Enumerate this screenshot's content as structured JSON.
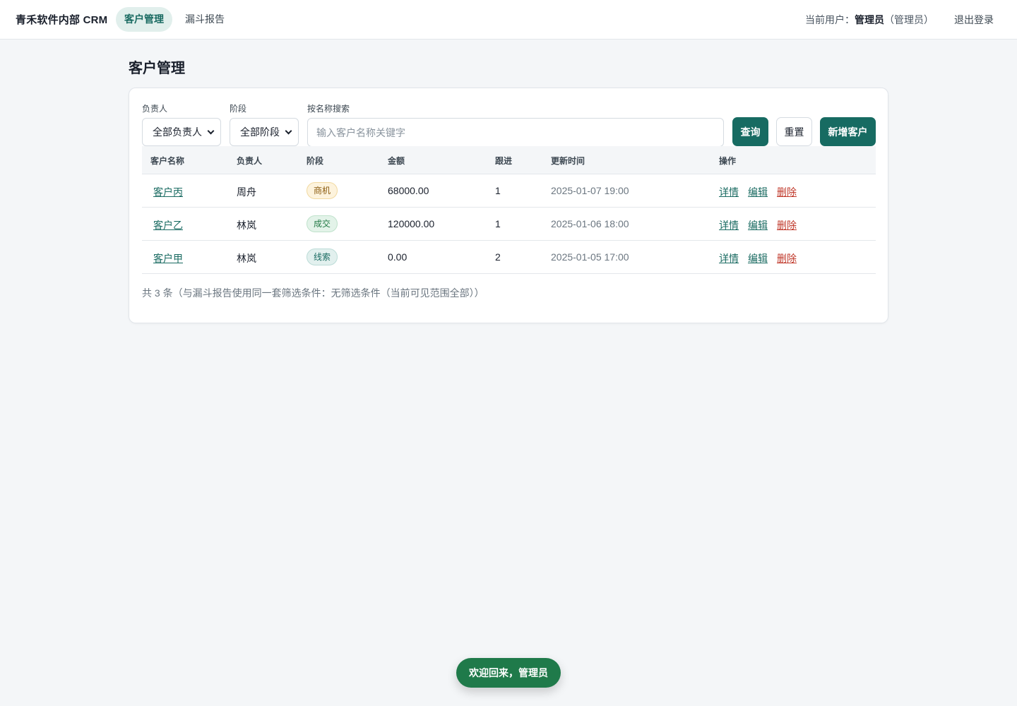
{
  "app": {
    "brand": "青禾软件内部 CRM",
    "nav": [
      {
        "label": "客户管理",
        "active": true
      },
      {
        "label": "漏斗报告",
        "active": false
      }
    ],
    "user_prefix": "当前用户：",
    "user_name": "管理员",
    "user_role": "（管理员）",
    "logout": "退出登录"
  },
  "page": {
    "title": "客户管理"
  },
  "filters": {
    "owner_label": "负责人",
    "owner_value": "全部负责人",
    "stage_label": "阶段",
    "stage_value": "全部阶段",
    "search_label": "按名称搜索",
    "search_placeholder": "输入客户名称关键字",
    "search_value": "",
    "query_button": "查询",
    "reset_button": "重置",
    "add_button": "新增客户"
  },
  "table": {
    "columns": [
      "客户名称",
      "负责人",
      "阶段",
      "金额",
      "跟进",
      "更新时间",
      "操作"
    ],
    "rows": [
      {
        "name": "客户丙",
        "owner": "周舟",
        "stage": "商机",
        "amount": "68000.00",
        "follow": "1",
        "updated": "2025-01-07 19:00"
      },
      {
        "name": "客户乙",
        "owner": "林岚",
        "stage": "成交",
        "amount": "120000.00",
        "follow": "1",
        "updated": "2025-01-06 18:00"
      },
      {
        "name": "客户甲",
        "owner": "林岚",
        "stage": "线索",
        "amount": "0.00",
        "follow": "2",
        "updated": "2025-01-05 17:00"
      }
    ],
    "actions": {
      "detail": "详情",
      "edit": "编辑",
      "delete": "删除"
    }
  },
  "summary": "共 3 条（与漏斗报告使用同一套筛选条件：无筛选条件（当前可见范围全部））",
  "toast": "欢迎回来，管理员",
  "colors": {
    "accent": "#176b62",
    "danger": "#c0392b",
    "toast": "#1f7a4a",
    "stage_opportunity": "#8a5a0e",
    "stage_won": "#237a46",
    "stage_lead": "#1a6b62"
  }
}
